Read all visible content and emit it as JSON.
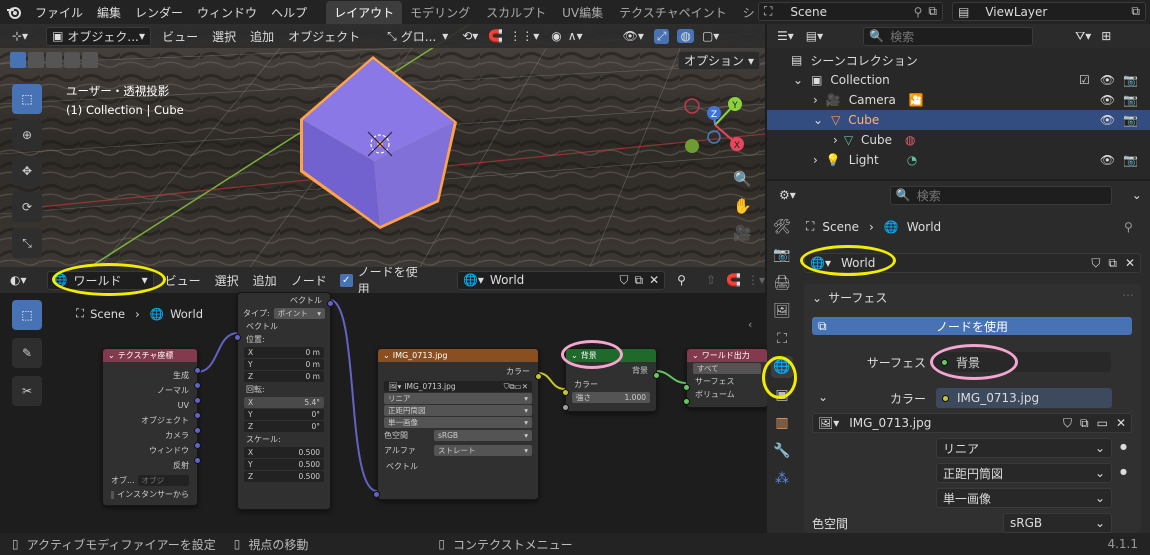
{
  "topbar": {
    "menus": [
      "ファイル",
      "編集",
      "レンダー",
      "ウィンドウ",
      "ヘルプ"
    ],
    "workspace_tabs": [
      "レイアウト",
      "モデリング",
      "スカルプト",
      "UV編集",
      "テクスチャペイント",
      "シ"
    ],
    "scene": "Scene",
    "view_layer": "ViewLayer"
  },
  "viewport": {
    "mode": "オブジェク...",
    "menus": [
      "ビュー",
      "選択",
      "追加",
      "オブジェクト"
    ],
    "transform_orientation": "グロ...",
    "info_line1": "ユーザー・透視投影",
    "info_line2": "(1) Collection | Cube",
    "options_label": "オプション",
    "gizmo_z": "Z",
    "gizmo_y": "Y",
    "gizmo_x": "X"
  },
  "node_editor": {
    "editor_type": "ワールド",
    "menus": [
      "ビュー",
      "選択",
      "追加",
      "ノード"
    ],
    "use_nodes_label": "ノードを使用",
    "world_name": "World",
    "breadcrumb_scene": "Scene",
    "breadcrumb_world": "World",
    "tex_coord": {
      "title": "テクスチャ座標",
      "outputs": [
        "生成",
        "ノーマル",
        "UV",
        "オブジェクト",
        "カメラ",
        "ウィンドウ",
        "反射"
      ],
      "object_label": "オブ...",
      "object_placeholder": "オブジ",
      "from_instancer": "インスタンサーから"
    },
    "mapping": {
      "output": "ベクトル",
      "type_label": "タイプ:",
      "type_value": "ポイント",
      "vector_input": "ベクトル",
      "location_label": "位置:",
      "location": [
        {
          "axis": "X",
          "value": "0 m"
        },
        {
          "axis": "Y",
          "value": "0 m"
        },
        {
          "axis": "Z",
          "value": "0 m"
        }
      ],
      "rotation_label": "回転:",
      "rotation": [
        {
          "axis": "X",
          "value": "5.4°"
        },
        {
          "axis": "Y",
          "value": "0°"
        },
        {
          "axis": "Z",
          "value": "0°"
        }
      ],
      "scale_label": "スケール:",
      "scale": [
        {
          "axis": "X",
          "value": "0.500"
        },
        {
          "axis": "Y",
          "value": "0.500"
        },
        {
          "axis": "Z",
          "value": "0.500"
        }
      ]
    },
    "image_node": {
      "title": "IMG_0713.jpg",
      "output": "カラー",
      "image": "IMG_0713.jpg",
      "interpolation": "リニア",
      "projection": "正距円筒図",
      "extension": "単一画像",
      "colorspace_label": "色空間",
      "colorspace": "sRGB",
      "alpha_label": "アルファ",
      "alpha": "ストレート",
      "vector_input": "ベクトル"
    },
    "background_node": {
      "title": "背景",
      "output": "背景",
      "color_input": "カラー",
      "strength_label": "強さ",
      "strength": "1.000"
    },
    "world_output": {
      "title": "ワールド出力",
      "target": "すべて",
      "surface": "サーフェス",
      "volume": "ボリューム"
    }
  },
  "outliner": {
    "search_placeholder": "検索",
    "scene_collection": "シーンコレクション",
    "rows": [
      {
        "name": "Collection"
      },
      {
        "name": "Camera"
      },
      {
        "name": "Cube"
      },
      {
        "name": "Cube"
      },
      {
        "name": "Light"
      }
    ]
  },
  "properties": {
    "search_placeholder": "検索",
    "breadcrumb_scene": "Scene",
    "breadcrumb_world": "World",
    "world_name": "World",
    "surface_panel": "サーフェス",
    "use_nodes_button": "ノードを使用",
    "surface_label": "サーフェス",
    "surface_value": "背景",
    "color_label": "カラー",
    "color_value": "IMG_0713.jpg",
    "image_name": "IMG_0713.jpg",
    "interpolation": "リニア",
    "projection": "正距円筒図",
    "extension": "単一画像",
    "colorspace_label": "色空間",
    "colorspace": "sRGB"
  },
  "statusbar": {
    "item1": "アクティブモディファイアーを設定",
    "item2": "視点の移動",
    "item3": "コンテクストメニュー",
    "version": "4.1.1"
  },
  "colors": {
    "accent": "#4772b3",
    "annotation_yellow": "#f2ec00",
    "annotation_pink": "#f3a6d0",
    "cube": "#7d6ad6",
    "selection_orange": "#f5a25d"
  }
}
